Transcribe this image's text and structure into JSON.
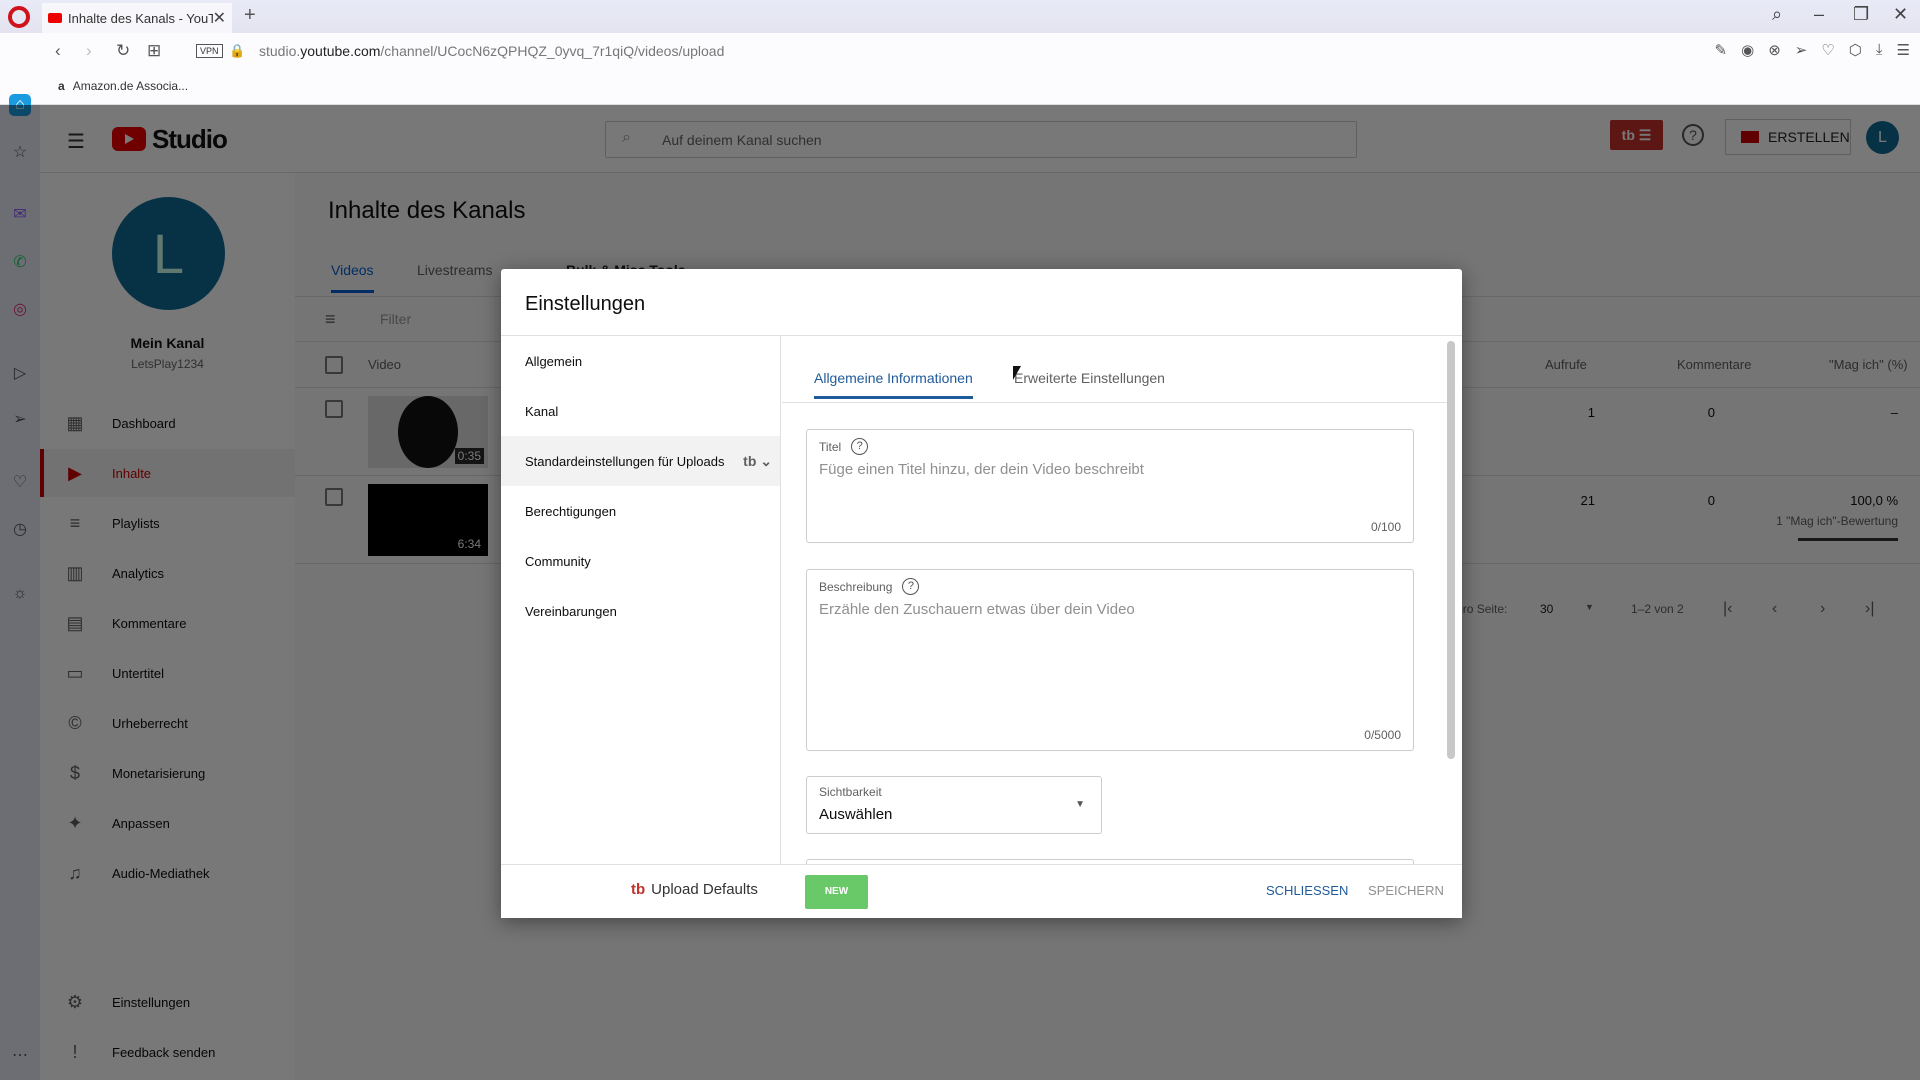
{
  "browser": {
    "tab_title": "Inhalte des Kanals - YouTube",
    "tab_close": "✕",
    "new_tab": "+",
    "url_prefix": "studio.",
    "url_domain": "youtube.com",
    "url_path": "/channel/UCocN6zQPHQZ_0yvq_7r1qiQ/videos/upload",
    "vpn_label": "VPN",
    "bookmark": "Amazon.de Associa...",
    "window_controls": {
      "search": "⌕",
      "minimize": "–",
      "restore": "❐",
      "close": "✕"
    },
    "nav": {
      "back": "‹",
      "forward": "›",
      "reload": "↻",
      "grid": "⊞"
    },
    "tools": [
      "✎",
      "◉",
      "⊗",
      "➢",
      "♡",
      "⬡",
      "⤓",
      "☰"
    ]
  },
  "opera_sidebar": [
    "⌂",
    "☆",
    "✉",
    "✆",
    "◎",
    "▷",
    "➢",
    "♡",
    "◷",
    "☼",
    "⋯"
  ],
  "header": {
    "app_name": "Studio",
    "search_placeholder": "Auf deinem Kanal suchen",
    "tb_label": "tb ☰",
    "help": "?",
    "create_label": "ERSTELLEN",
    "avatar_letter": "L"
  },
  "channel": {
    "avatar_letter": "L",
    "name": "Mein Kanal",
    "handle": "LetsPlay1234"
  },
  "nav": {
    "items": [
      {
        "label": "Dashboard",
        "icon": "▦"
      },
      {
        "label": "Inhalte",
        "icon": "▶"
      },
      {
        "label": "Playlists",
        "icon": "≡"
      },
      {
        "label": "Analytics",
        "icon": "▥"
      },
      {
        "label": "Kommentare",
        "icon": "▤"
      },
      {
        "label": "Untertitel",
        "icon": "▭"
      },
      {
        "label": "Urheberrecht",
        "icon": "©"
      },
      {
        "label": "Monetarisierung",
        "icon": "$"
      },
      {
        "label": "Anpassen",
        "icon": "✦"
      },
      {
        "label": "Audio-Mediathek",
        "icon": "♫"
      }
    ],
    "bottom": [
      {
        "label": "Einstellungen",
        "icon": "⚙"
      },
      {
        "label": "Feedback senden",
        "icon": "!"
      }
    ],
    "active_index": 1
  },
  "content": {
    "title": "Inhalte des Kanals",
    "tabs": [
      "Videos",
      "Livestreams",
      "Bulk & Misc Tools"
    ],
    "filter_placeholder": "Filter",
    "columns": {
      "video": "Video",
      "views": "Aufrufe",
      "comments": "Kommentare",
      "likes": "\"Mag ich\" (%)"
    },
    "rows": [
      {
        "duration": "0:35",
        "views": "1",
        "comments": "0",
        "likes": "–",
        "likes_sub": ""
      },
      {
        "duration": "6:34",
        "views": "21",
        "comments": "0",
        "likes": "100,0 %",
        "likes_sub": "1 \"Mag ich\"-Bewertung"
      }
    ],
    "pager": {
      "rows_per_page_label": "Zeilen pro Seite:",
      "rows_per_page": "30",
      "range": "1–2 von 2",
      "first": "|‹",
      "prev": "‹",
      "next": "›",
      "last": "›|"
    }
  },
  "modal": {
    "title": "Einstellungen",
    "menu": [
      {
        "label": "Allgemein"
      },
      {
        "label": "Kanal"
      },
      {
        "label": "Standardeinstellungen für Uploads",
        "extra": "tb ⌄"
      },
      {
        "label": "Berechtigungen"
      },
      {
        "label": "Community"
      },
      {
        "label": "Vereinbarungen"
      }
    ],
    "active_menu_index": 2,
    "tabs": [
      "Allgemeine Informationen",
      "Erweiterte Einstellungen"
    ],
    "active_tab_index": 0,
    "title_field": {
      "label": "Titel",
      "placeholder": "Füge einen Titel hinzu, der dein Video beschreibt",
      "counter": "0/100"
    },
    "description_field": {
      "label": "Beschreibung",
      "placeholder": "Erzähle den Zuschauern etwas über dein Video",
      "counter": "0/5000"
    },
    "visibility": {
      "label": "Sichtbarkeit",
      "value": "Auswählen"
    },
    "footer": {
      "brand": "Upload Defaults",
      "brand_icon": "tb",
      "new_badge": "NEW",
      "close": "SCHLIESSEN",
      "save": "SPEICHERN"
    }
  }
}
